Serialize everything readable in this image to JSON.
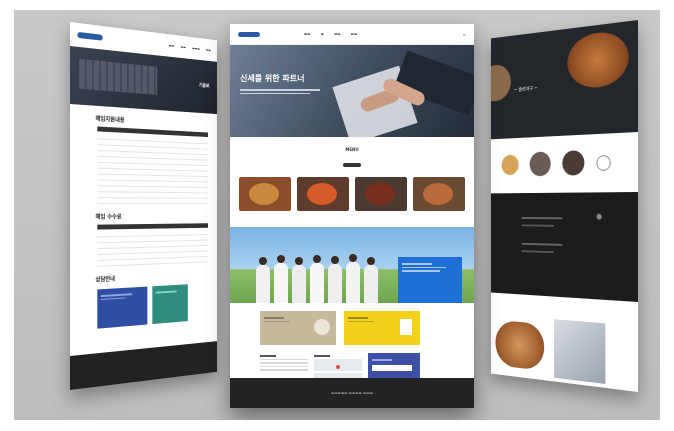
{
  "colors": {
    "backdrop": "#c4c4c4",
    "brand_blue": "#2a5aa6",
    "accent_blue": "#1e6fd6",
    "accent_yellow": "#f2d21a",
    "footer_dark": "#232323"
  },
  "left_page": {
    "hero_text": "기술보",
    "table1_title": "매입지원내용",
    "table2_title": "매입 수수료",
    "cards_title": "상담안내"
  },
  "center_page": {
    "hero_title": "신세를 위한 파트너",
    "menu_label": "MENU"
  },
  "right_page": {
    "logo_text": "~ 술로야구 ~"
  }
}
